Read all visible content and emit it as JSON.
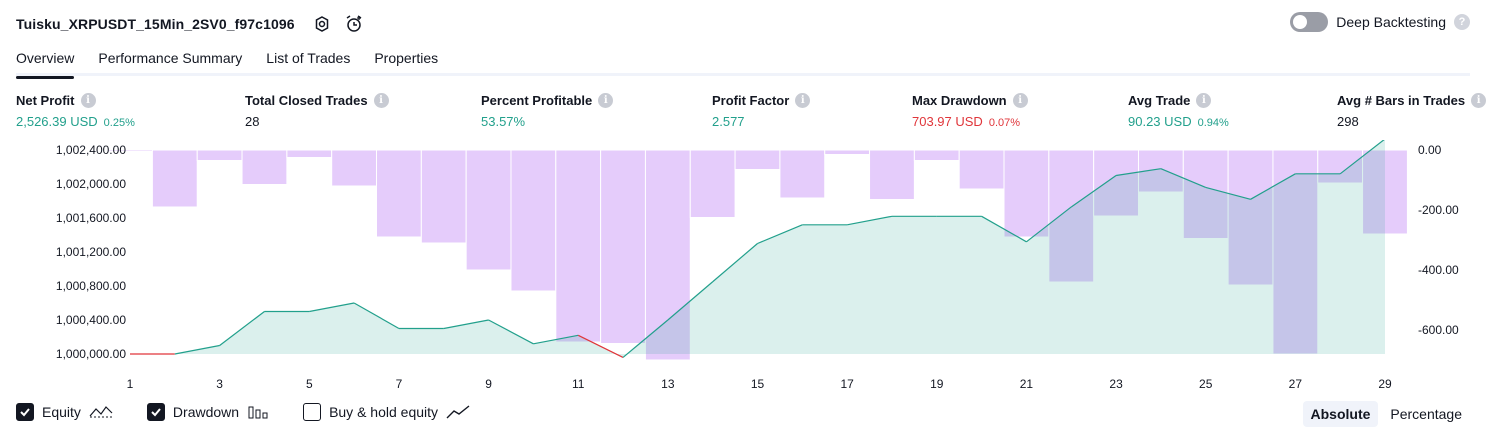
{
  "header": {
    "strategy_name": "Tuisku_XRPUSDT_15Min_2SV0_f97c1096",
    "deep_backtesting_label": "Deep Backtesting",
    "deep_backtesting_enabled": false,
    "help_glyph": "?"
  },
  "tabs": [
    {
      "label": "Overview",
      "active": true
    },
    {
      "label": "Performance Summary",
      "active": false
    },
    {
      "label": "List of Trades",
      "active": false
    },
    {
      "label": "Properties",
      "active": false
    }
  ],
  "metrics": {
    "net_profit": {
      "label": "Net Profit",
      "value": "2,526.39 USD",
      "pct": "0.25%"
    },
    "total_closed_trades": {
      "label": "Total Closed Trades",
      "value": "28"
    },
    "percent_profitable": {
      "label": "Percent Profitable",
      "value": "53.57%"
    },
    "profit_factor": {
      "label": "Profit Factor",
      "value": "2.577"
    },
    "max_drawdown": {
      "label": "Max Drawdown",
      "value": "703.97 USD",
      "pct": "0.07%"
    },
    "avg_trade": {
      "label": "Avg Trade",
      "value": "90.23 USD",
      "pct": "0.94%"
    },
    "avg_bars": {
      "label": "Avg # Bars in Trades",
      "value": "298"
    }
  },
  "info_glyph": "i",
  "chart_data": {
    "type": "area",
    "x": [
      1,
      2,
      3,
      4,
      5,
      6,
      7,
      8,
      9,
      10,
      11,
      12,
      13,
      14,
      15,
      16,
      17,
      18,
      19,
      20,
      21,
      22,
      23,
      24,
      25,
      26,
      27,
      28,
      29
    ],
    "x_tick_labels": [
      "1",
      "3",
      "5",
      "7",
      "9",
      "11",
      "13",
      "15",
      "17",
      "19",
      "21",
      "23",
      "25",
      "27",
      "29"
    ],
    "equity": {
      "name": "Equity",
      "values": [
        1000000,
        1000000,
        1000100,
        1000500,
        1000500,
        1000600,
        1000300,
        1000300,
        1000400,
        1000120,
        1000220,
        999960,
        1000400,
        1000850,
        1001300,
        1001520,
        1001520,
        1001620,
        1001620,
        1001620,
        1001320,
        1001730,
        1002100,
        1002180,
        1001960,
        1001820,
        1002120,
        1002120,
        1002530
      ],
      "color_up": "#22a08c",
      "color_down": "#e0353a"
    },
    "drawdown": {
      "name": "Drawdown",
      "values": [
        -5,
        -190,
        -35,
        -115,
        -25,
        -120,
        -290,
        -310,
        -400,
        -470,
        -640,
        -645,
        -700,
        -225,
        -65,
        -160,
        -15,
        -165,
        -35,
        -130,
        -290,
        -440,
        -220,
        -140,
        -295,
        -450,
        -680,
        -110,
        -280
      ],
      "color": "#e1c3fa"
    },
    "left_axis": {
      "ticks": [
        "1,000,000.00",
        "1,000,400.00",
        "1,000,800.00",
        "1,001,200.00",
        "1,001,600.00",
        "1,002,000.00",
        "1,002,400.00"
      ],
      "min": 999900,
      "max": 1002600
    },
    "right_axis": {
      "ticks": [
        "0.00",
        "-200.00",
        "-400.00",
        "-600.00"
      ],
      "min": -700,
      "max": 0
    },
    "grid": false
  },
  "legend": {
    "equity_label": "Equity",
    "drawdown_label": "Drawdown",
    "buy_hold_label": "Buy & hold equity",
    "equity_checked": true,
    "drawdown_checked": true,
    "buy_hold_checked": false
  },
  "scale": {
    "absolute_label": "Absolute",
    "percentage_label": "Percentage",
    "active": "Absolute"
  }
}
